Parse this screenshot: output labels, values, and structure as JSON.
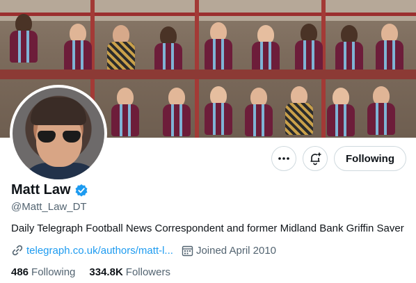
{
  "profile": {
    "name": "Matt Law",
    "handle": "@Matt_Law_DT",
    "bio": "Daily Telegraph Football News Correspondent and former Midland Bank Griffin Saver",
    "website": "telegraph.co.uk/authors/matt-l...",
    "joined": "Joined April 2010",
    "following_count": "486",
    "following_label": "Following",
    "followers_count": "334.8K",
    "followers_label": "Followers",
    "verified": true
  },
  "actions": {
    "more_icon": "more-dots-icon",
    "notify_icon": "bell-plus-icon",
    "follow_label": "Following"
  },
  "colors": {
    "accent": "#1d9bf0",
    "text_primary": "#0f1419",
    "text_secondary": "#536471",
    "border": "#cfd9de"
  }
}
